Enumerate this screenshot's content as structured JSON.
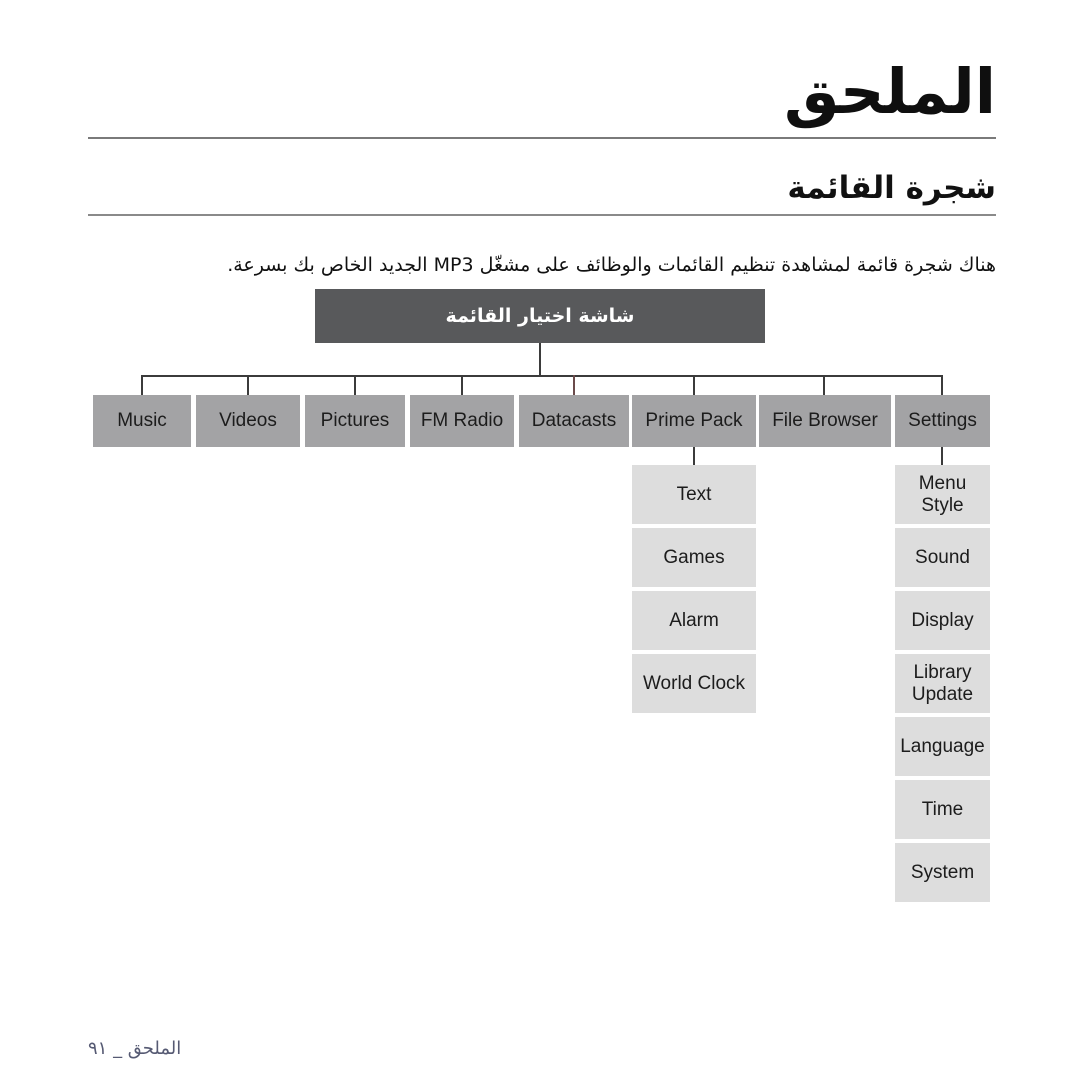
{
  "page": {
    "title": "الملحق",
    "section_title": "شجرة القائمة",
    "intro": "هناك شجرة قائمة لمشاهدة تنظيم القائمات والوظائف على مشغّل MP3 الجديد الخاص بك بسرعة.",
    "footer": "الملحق _ ٩١"
  },
  "colors": {
    "root_node_bg": "#58595b",
    "root_node_text": "#ffffff",
    "level1_bg": "#a3a3a5",
    "level2_bg": "#dddddd",
    "node_text": "#1c1c1c",
    "connector": "#3b3b3b",
    "rule": "#7a7a7a",
    "footer_text": "#565a73"
  },
  "tree": {
    "root": {
      "label": "شاشة اختيار القائمة"
    },
    "level1": [
      {
        "label": "Music"
      },
      {
        "label": "Videos"
      },
      {
        "label": "Pictures"
      },
      {
        "label": "FM Radio"
      },
      {
        "label": "Datacasts"
      },
      {
        "label": "Prime Pack"
      },
      {
        "label": "File Browser"
      },
      {
        "label": "Settings"
      }
    ],
    "prime_pack_children": [
      {
        "label": "Text"
      },
      {
        "label": "Games"
      },
      {
        "label": "Alarm"
      },
      {
        "label": "World Clock"
      }
    ],
    "settings_children": [
      {
        "label": "Menu\nStyle"
      },
      {
        "label": "Sound"
      },
      {
        "label": "Display"
      },
      {
        "label": "Library\nUpdate"
      },
      {
        "label": "Language"
      },
      {
        "label": "Time"
      },
      {
        "label": "System"
      }
    ]
  }
}
